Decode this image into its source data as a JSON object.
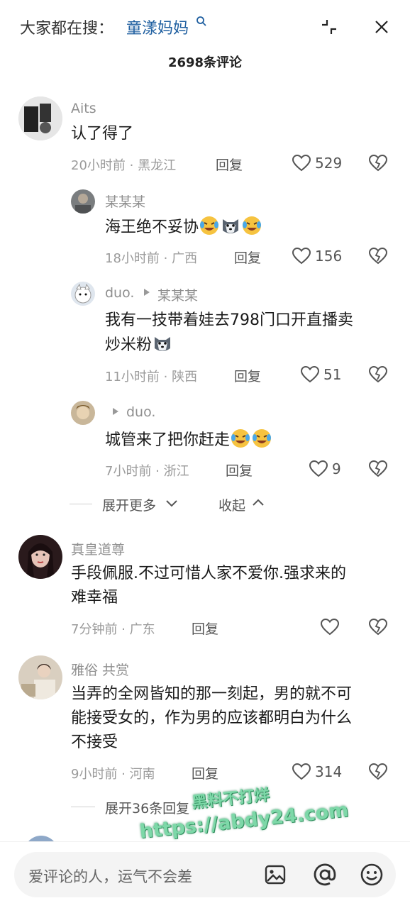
{
  "header": {
    "search_prefix": "大家都在搜：",
    "search_term": "童漾妈妈",
    "comment_count": "2698条评论"
  },
  "comments": [
    {
      "name": "Aits",
      "text": "认了得了",
      "time_location": "20小时前 · 黑龙江",
      "reply_label": "回复",
      "likes": "529"
    },
    {
      "name": "某某某",
      "text": "海王绝不妥协",
      "time_location": "18小时前 · 广西",
      "reply_label": "回复",
      "likes": "156"
    },
    {
      "name": "duo.",
      "reply_to": "某某某",
      "text_line1": "我有一技带着娃去798门口开直播卖",
      "text_line2": "炒米粉",
      "time_location": "11小时前 · 陕西",
      "reply_label": "回复",
      "likes": "51"
    },
    {
      "reply_to": "duo.",
      "text": "城管来了把你赶走",
      "time_location": "7小时前 · 浙江",
      "reply_label": "回复",
      "likes": "9"
    },
    {
      "name": "真皇道尊",
      "text_line1": "手段佩服.不过可惜人家不爱你.强求来的",
      "text_line2": "难幸福",
      "time_location": "7分钟前 · 广东",
      "reply_label": "回复",
      "likes": ""
    },
    {
      "name": "雅俗 共赏",
      "text_line1": "当弄的全网皆知的那一刻起，男的就不可",
      "text_line2": "能接受女的，作为男的应该都明白为什么",
      "text_line3": "不接受",
      "time_location": "9小时前 · 河南",
      "reply_label": "回复",
      "likes": "314"
    }
  ],
  "thread_controls": {
    "expand_more": "展开更多",
    "collapse": "收起",
    "expand_replies": "展开36条回复"
  },
  "watermark": {
    "line1": "黑料不打烊",
    "line2": "https://abdy24.com"
  },
  "bottom": {
    "placeholder": "爱评论的人，运气不会差"
  }
}
